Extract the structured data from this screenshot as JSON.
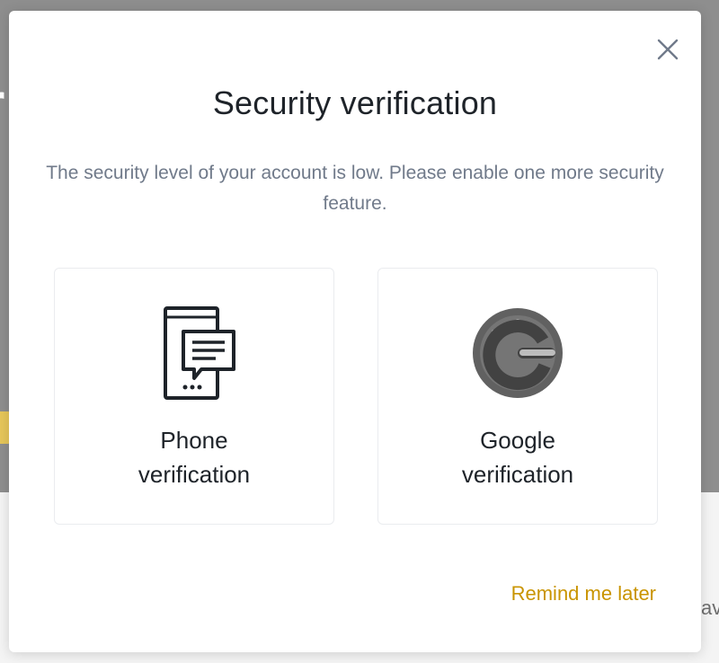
{
  "modal": {
    "title": "Security verification",
    "subtitle": "The security level of your account is low. Please enable one more security feature.",
    "options": [
      {
        "label": "Phone verification",
        "icon": "phone-message-icon"
      },
      {
        "label": "Google verification",
        "icon": "google-authenticator-icon"
      }
    ],
    "remind_label": "Remind me later",
    "close_icon": "close-icon"
  },
  "background": {
    "left_fragment": "r",
    "right_fragment": "av"
  },
  "colors": {
    "accent": "#c99400",
    "title": "#1e2329",
    "subtitle": "#707a8a",
    "overlay": "#8e8e8e"
  }
}
